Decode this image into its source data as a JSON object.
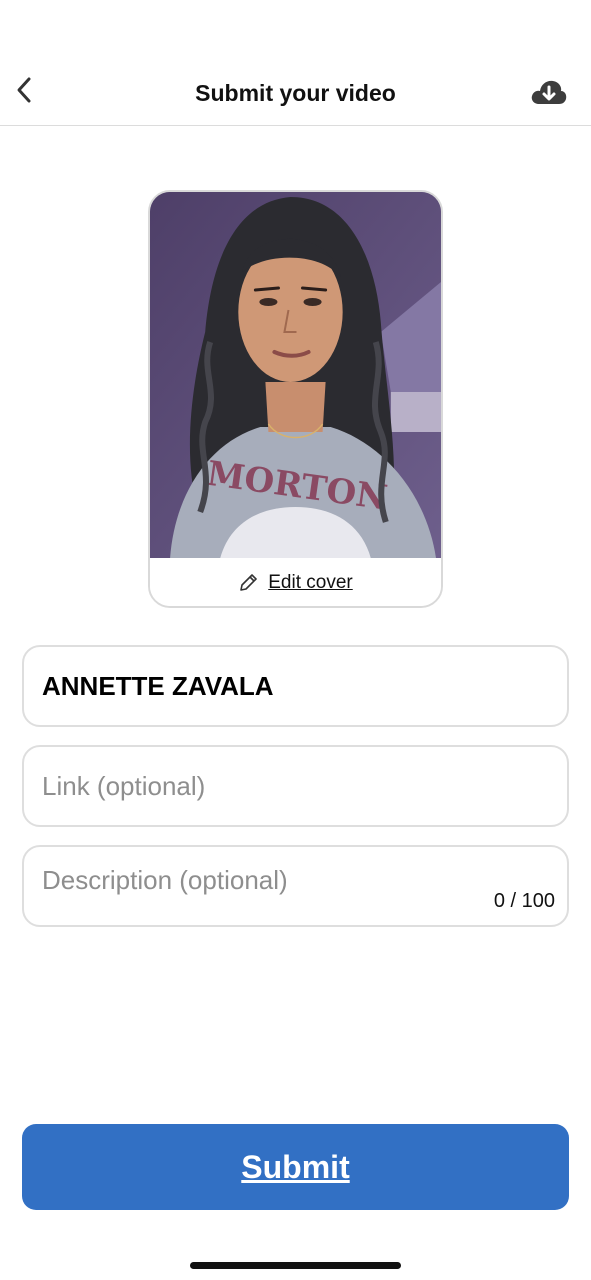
{
  "header": {
    "title": "Submit your video",
    "back_icon": "chevron-left-icon",
    "download_icon": "cloud-download-icon"
  },
  "cover": {
    "edit_label": "Edit cover",
    "edit_icon": "pencil-icon"
  },
  "form": {
    "name_value": "ANNETTE ZAVALA",
    "link_value": "",
    "link_placeholder": "Link (optional)",
    "description_value": "",
    "description_placeholder": "Description (optional)",
    "description_counter": "0 / 100"
  },
  "submit": {
    "label": "Submit",
    "color": "#3270c4"
  }
}
